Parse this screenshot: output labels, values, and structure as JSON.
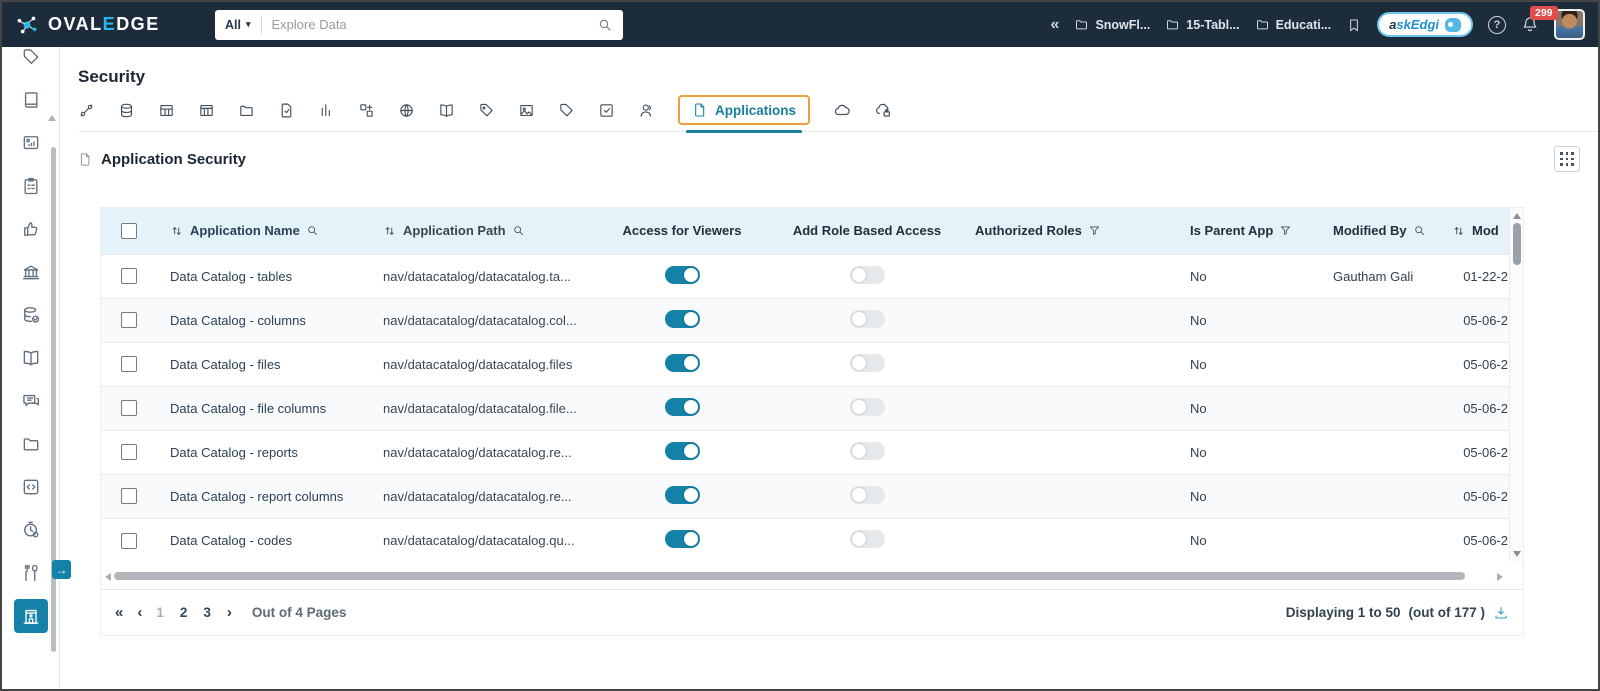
{
  "topbar": {
    "logo": {
      "p1": "OVAL",
      "accent": "E",
      "p2": "DGE"
    },
    "search": {
      "scope": "All",
      "placeholder": "Explore Data"
    },
    "pins": [
      {
        "label": "SnowFl..."
      },
      {
        "label": "15-Tabl..."
      },
      {
        "label": "Educati..."
      }
    ],
    "askedgi": {
      "a": "a",
      "rest": "skEdgi"
    },
    "notifications": {
      "count": "299"
    }
  },
  "sidebar": {
    "items": [
      {
        "icon": "tag"
      },
      {
        "icon": "journal"
      },
      {
        "icon": "report"
      },
      {
        "icon": "tasks"
      },
      {
        "icon": "endorse"
      },
      {
        "icon": "governance"
      },
      {
        "icon": "data-quality"
      },
      {
        "icon": "glossary"
      },
      {
        "icon": "collaboration"
      },
      {
        "icon": "projects"
      },
      {
        "icon": "query"
      },
      {
        "icon": "jobs"
      },
      {
        "icon": "tools"
      },
      {
        "icon": "administration",
        "active": true
      }
    ]
  },
  "page": {
    "title": "Security",
    "tabs": {
      "icons": [
        "connectors",
        "databases",
        "tables",
        "table-columns",
        "folders",
        "file-check",
        "reports",
        "report-columns",
        "web",
        "codes",
        "tag-badge",
        "media",
        "tags",
        "check-square",
        "users"
      ],
      "active": {
        "label": "Applications"
      },
      "trailing_icons": [
        "cloud-api",
        "cloud-lock"
      ]
    },
    "section_title": "Application Security"
  },
  "table": {
    "headers": {
      "name": "Application Name",
      "path": "Application Path",
      "viewers": "Access for Viewers",
      "role_access": "Add Role Based Access",
      "roles": "Authorized Roles",
      "parent": "Is Parent App",
      "modified_by": "Modified By",
      "modified_date": "Mod"
    },
    "rows": [
      {
        "name": "Data Catalog - tables",
        "path": "nav/datacatalog/datacatalog.ta...",
        "viewers": "on",
        "role_access": "off",
        "roles": "",
        "parent": "No",
        "modified_by": "Gautham Gali",
        "date": "01-22-2"
      },
      {
        "name": "Data Catalog - columns",
        "path": "nav/datacatalog/datacatalog.col...",
        "viewers": "on",
        "role_access": "off",
        "roles": "",
        "parent": "No",
        "modified_by": "",
        "date": "05-06-2"
      },
      {
        "name": "Data Catalog - files",
        "path": "nav/datacatalog/datacatalog.files",
        "viewers": "on",
        "role_access": "off",
        "roles": "",
        "parent": "No",
        "modified_by": "",
        "date": "05-06-2"
      },
      {
        "name": "Data Catalog - file columns",
        "path": "nav/datacatalog/datacatalog.file...",
        "viewers": "on",
        "role_access": "off",
        "roles": "",
        "parent": "No",
        "modified_by": "",
        "date": "05-06-2"
      },
      {
        "name": "Data Catalog - reports",
        "path": "nav/datacatalog/datacatalog.re...",
        "viewers": "on",
        "role_access": "off",
        "roles": "",
        "parent": "No",
        "modified_by": "",
        "date": "05-06-2"
      },
      {
        "name": "Data Catalog - report columns",
        "path": "nav/datacatalog/datacatalog.re...",
        "viewers": "on",
        "role_access": "off",
        "roles": "",
        "parent": "No",
        "modified_by": "",
        "date": "05-06-2"
      },
      {
        "name": "Data Catalog - codes",
        "path": "nav/datacatalog/datacatalog.qu...",
        "viewers": "on",
        "role_access": "off",
        "roles": "",
        "parent": "No",
        "modified_by": "",
        "date": "05-06-2"
      }
    ]
  },
  "pagination": {
    "first": "«",
    "prev": "‹",
    "page1": "1",
    "page2": "2",
    "page3": "3",
    "next": "›",
    "out_of": "Out of 4 Pages",
    "displaying": "Displaying 1 to 50",
    "total": "(out of 177 )"
  },
  "colors": {
    "topbar_bg": "#1d2c3b",
    "accent_teal": "#1482a6",
    "active_tab_border": "#eaa33c",
    "header_bg": "#e4f2f9",
    "badge_red": "#e14b4b"
  }
}
